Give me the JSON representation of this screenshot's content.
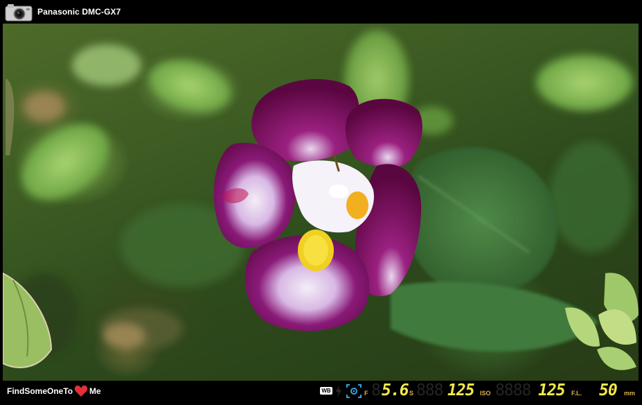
{
  "header": {
    "camera_icon": "camera-icon",
    "camera_model": "Panasonic DMC-GX7"
  },
  "photo": {
    "subject": "purple-white-flower-photo"
  },
  "footer": {
    "brand_text": "FindSomeOneTo",
    "brand_suffix": "Me",
    "heart_icon": "heart-icon",
    "heart_color": "#e0303a"
  },
  "exif": {
    "wb_label": "WB",
    "flash_icon": "flash-icon",
    "metering_icon": "metering-icon",
    "aperture_label": "F",
    "aperture_value": "5.6",
    "shutter_label": "S",
    "shutter_value": "125",
    "iso_label": "ISO",
    "iso_value": "125",
    "focal_label": "F.L.",
    "focal_value": "50",
    "focal_unit": "mm",
    "accent_color": "#f4e94c",
    "label_color": "#e0b050"
  }
}
